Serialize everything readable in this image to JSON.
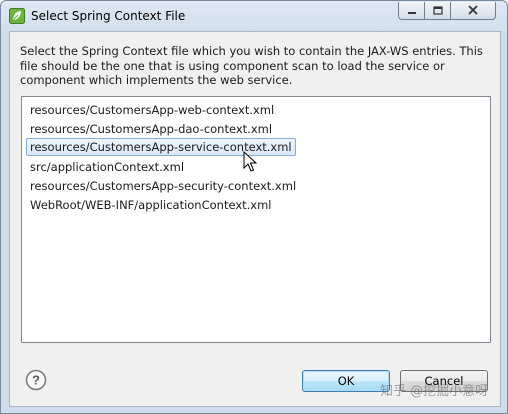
{
  "window": {
    "title": "Select Spring Context File",
    "app_icon": "spring-leaf-icon",
    "controls": [
      "minimize-icon",
      "maximize-icon",
      "close-icon"
    ]
  },
  "dialog": {
    "description": "Select the Spring Context file which you wish to contain the JAX-WS entries.  This file should be the one that is using component scan to load the service or component which implements the web service.",
    "files": [
      "resources/CustomersApp-web-context.xml",
      "resources/CustomersApp-dao-context.xml",
      "resources/CustomersApp-service-context.xml",
      "src/applicationContext.xml",
      "resources/CustomersApp-security-context.xml",
      "WebRoot/WEB-INF/applicationContext.xml"
    ],
    "selected_index": 2
  },
  "buttons": {
    "ok": "OK",
    "cancel": "Cancel",
    "help_icon": "help-icon"
  },
  "overlay": {
    "watermark": "知乎 @挖掘小意呀"
  },
  "colors": {
    "selection_border": "#84acdd",
    "ok_border": "#3c7fb1"
  }
}
